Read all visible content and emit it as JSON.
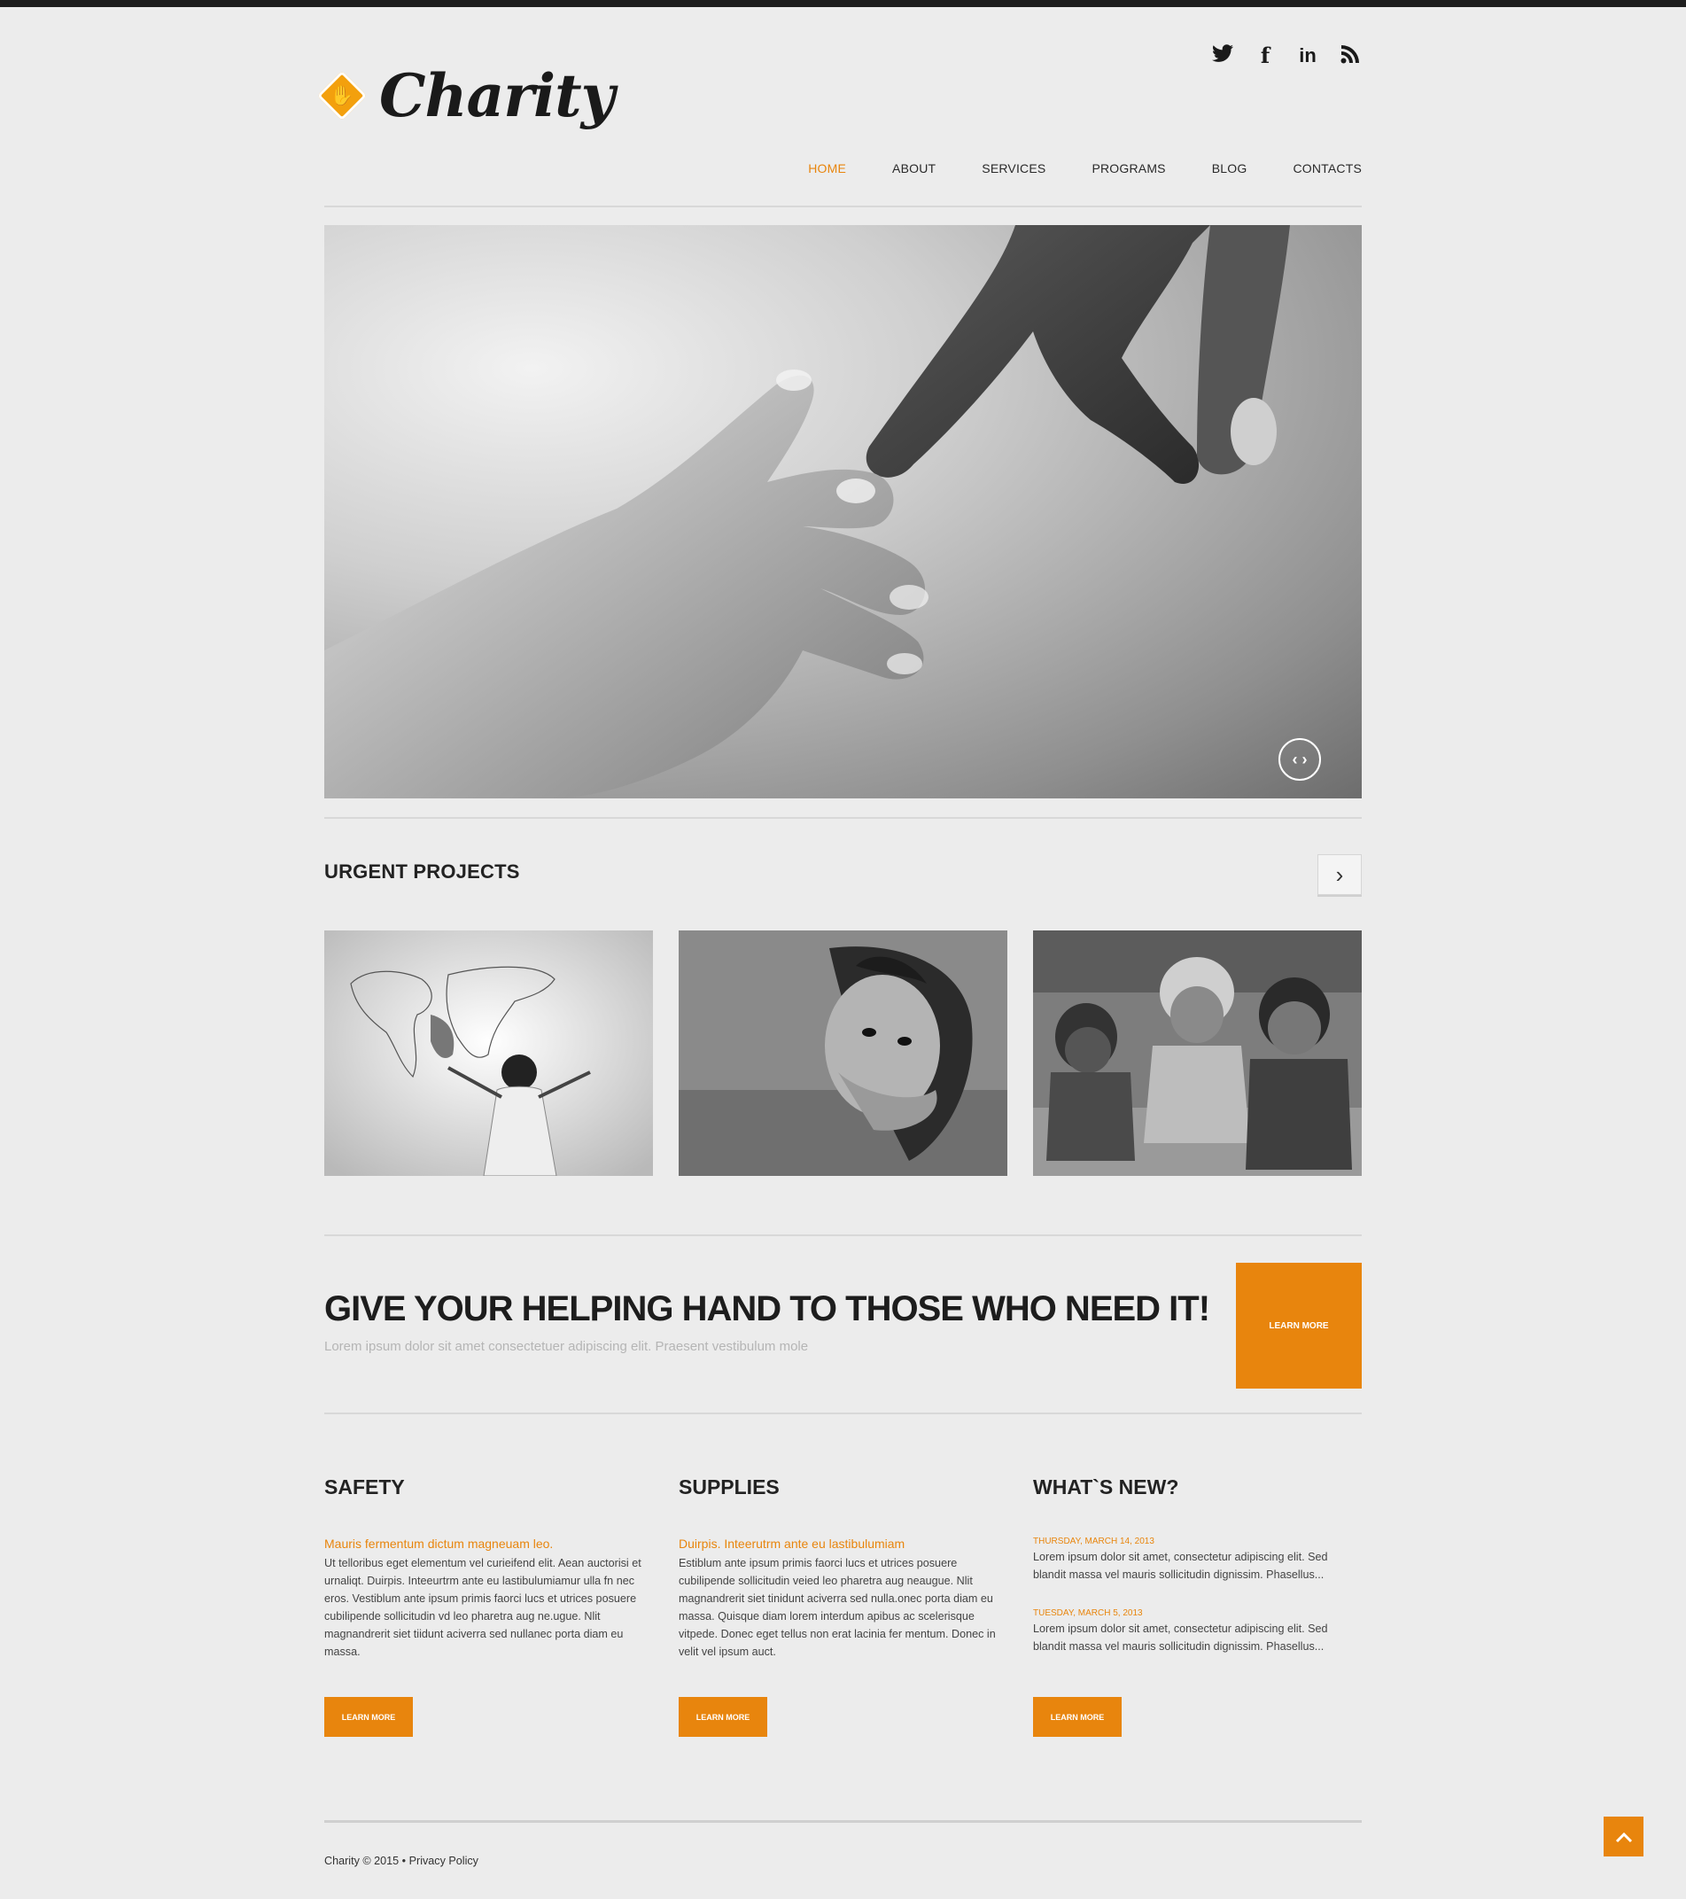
{
  "brand": {
    "name": "Charity",
    "logo_icon": "hand-icon",
    "accent": "#e8850d"
  },
  "social": [
    {
      "icon": "twitter-icon",
      "glyph": "🐦"
    },
    {
      "icon": "facebook-icon",
      "glyph": "f"
    },
    {
      "icon": "linkedin-icon",
      "glyph": "in"
    },
    {
      "icon": "rss-icon",
      "glyph": "◔"
    }
  ],
  "nav": {
    "items": [
      "HOME",
      "ABOUT",
      "SERVICES",
      "PROGRAMS",
      "BLOG",
      "CONTACTS"
    ],
    "active": "HOME"
  },
  "hero": {
    "control_icon": "slider-arrows-icon",
    "control_glyph": "‹ ›"
  },
  "urgent": {
    "title": "URGENT PROJECTS",
    "next_glyph": "›"
  },
  "cta": {
    "title": "GIVE YOUR HELPING HAND TO THOSE WHO NEED IT!",
    "subtitle": "Lorem ipsum dolor sit amet consectetuer adipiscing elit. Praesent vestibulum mole",
    "button": "LEARN MORE"
  },
  "columns": {
    "safety": {
      "title": "SAFETY",
      "lead": "Mauris fermentum dictum magneuam leo.",
      "body": "Ut telloribus eget elementum vel curieifend elit. Aean auctorisi et urnaliqt. Duirpis. Inteeurtrm ante eu lastibulumiamur ulla fn nec eros. Vestiblum ante ipsum primis faorci lucs et utrices posuere cubilipende sollicitudin vd leo pharetra aug ne.ugue. Nlit magnandrerit siet tiidunt aciverra sed nullanec porta diam eu massa.",
      "button": "LEARN MORE"
    },
    "supplies": {
      "title": "SUPPLIES",
      "lead": "Duirpis. Inteerutrm ante eu lastibulumiam",
      "body": "Estiblum ante ipsum primis faorci lucs et utrices posuere cubilipende sollicitudin veied leo pharetra aug neaugue. Nlit magnandrerit siet tinidunt aciverra sed nulla.onec porta diam eu massa. Quisque diam lorem interdum apibus ac scelerisque vitpede. Donec eget tellus non erat lacinia fer mentum. Donec in velit vel ipsum auct.",
      "button": "LEARN MORE"
    },
    "news": {
      "title": "WHAT`S NEW?",
      "items": [
        {
          "date": "THURSDAY, MARCH 14, 2013",
          "text": "Lorem ipsum dolor sit amet, consectetur adipiscing elit. Sed blandit massa vel mauris sollicitudin dignissim. Phasellus..."
        },
        {
          "date": "TUESDAY, MARCH 5, 2013",
          "text": "Lorem ipsum dolor sit amet, consectetur adipiscing elit. Sed blandit massa vel mauris sollicitudin dignissim. Phasellus..."
        }
      ],
      "button": "LEARN MORE"
    }
  },
  "footer": {
    "copyright": "Charity © 2015 •",
    "privacy": "Privacy Policy"
  },
  "to_top": {
    "icon": "arrow-up-icon",
    "glyph": "⌃"
  }
}
